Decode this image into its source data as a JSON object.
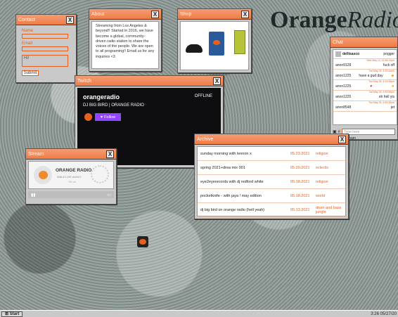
{
  "brand": {
    "bold": "range",
    "italic": "Radio"
  },
  "contact": {
    "title": "Contact",
    "name_label": "Name",
    "email_label": "Email",
    "message_value": "Hi!",
    "submit": "Submit"
  },
  "about": {
    "title": "About",
    "text": "Streaming from Los Angeles & beyond!! Started in 2016, we have become a global, community-driven radio station to share the voices of the people. We are open to all programing!! Email us for any inquiries <3"
  },
  "shop": {
    "title": "Shop"
  },
  "chat": {
    "title": "Chat",
    "messages": [
      {
        "user": "dellisasco",
        "text": "pogger",
        "ts": ""
      },
      {
        "user": "anon9128",
        "text": "fuck off",
        "ts": "Wed May 12, 11:48:14pm"
      },
      {
        "user": "anon1225",
        "text": "have a gud day",
        "ts": "Tue May 25, 4:29:30pm"
      },
      {
        "user": "anon1225",
        "text": "",
        "ts": "Tue May 25, 4:29:35pm"
      },
      {
        "user": "anon1225",
        "text": "oh hell yis",
        "ts": "Tue May 25, 4:59:56pm"
      },
      {
        "user": "anon8548",
        "text": "jet",
        "ts": "Tue May 25, 4:59:30pm"
      }
    ],
    "input_placeholder": "Type here",
    "online": "1",
    "set_name": "Set nam"
  },
  "twitch": {
    "title": "Twitch",
    "channel": "orangeradio",
    "status": "OFFLINE",
    "stream_title": "DJ BIG BIRD | ORANGE RADIO",
    "follow": "Follow"
  },
  "stream": {
    "title": "Stream",
    "station": "ORANGE RADIO",
    "subtitle": "WALK LIVE AUDIO",
    "status": "Off-air"
  },
  "archive": {
    "title": "Archive",
    "rows": [
      {
        "title": "sunday morning with lennon x",
        "date": "05.23.2021",
        "genre": "religion"
      },
      {
        "title": "spring 2021+drea mix 001",
        "date": "05.20.2021",
        "genre": "eclectic"
      },
      {
        "title": "eye2eyerecords with dj redford white",
        "date": "05.18.2021",
        "genre": "religion"
      },
      {
        "title": "pocketknife - with jaya ! may edition",
        "date": "05.18.2021",
        "genre": "world"
      },
      {
        "title": "dj big bird on orange radio (hell yeah)",
        "date": "05.13.2021",
        "genre": "drum and bass jungle"
      }
    ]
  },
  "taskbar": {
    "start": "Start",
    "clock": "3:26",
    "date": "05/27/20"
  },
  "colors": {
    "accent": "#e8601e",
    "titlebar": "#f07c46",
    "twitch_purple": "#9146ff"
  }
}
